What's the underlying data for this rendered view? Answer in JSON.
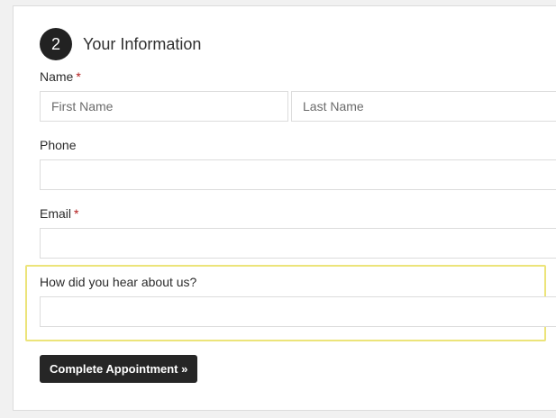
{
  "section": {
    "step_number": "2",
    "title": "Your Information"
  },
  "fields": {
    "name": {
      "label": "Name",
      "required_mark": "*",
      "first_placeholder": "First Name",
      "last_placeholder": "Last Name",
      "first_value": "",
      "last_value": ""
    },
    "phone": {
      "label": "Phone",
      "value": ""
    },
    "email": {
      "label": "Email",
      "required_mark": "*",
      "value": ""
    },
    "referral": {
      "label": "How did you hear about us?",
      "value": ""
    }
  },
  "submit": {
    "label": "Complete Appointment »"
  },
  "colors": {
    "accent_dark": "#262626",
    "required": "#b31b1b",
    "highlight": "#ece47a"
  }
}
